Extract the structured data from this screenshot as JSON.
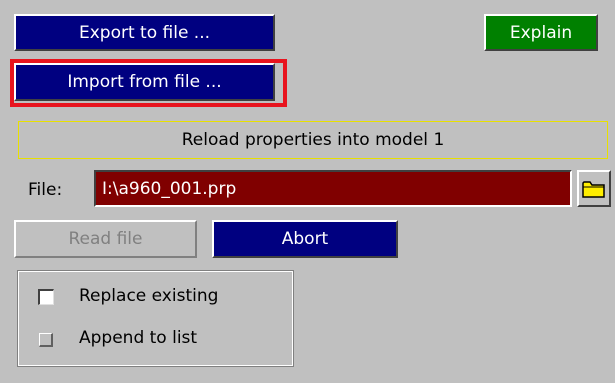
{
  "toolbar": {
    "export_label": "Export to file ...",
    "import_label": "Import from file ...",
    "explain_label": "Explain"
  },
  "panel": {
    "title": "Reload properties into model 1"
  },
  "file": {
    "label": "File:",
    "value": "I:\\a960_001.prp",
    "folder_icon": "folder-icon"
  },
  "actions": {
    "read_label": "Read file",
    "abort_label": "Abort"
  },
  "options": {
    "replace_label": "Replace existing",
    "append_label": "Append to list"
  },
  "colors": {
    "background": "#c0c0c0",
    "button_navy": "#000080",
    "button_green": "#008000",
    "file_field": "#800000",
    "highlight": "#e8141e",
    "title_border": "#e8e000",
    "folder": "#ffee00"
  }
}
